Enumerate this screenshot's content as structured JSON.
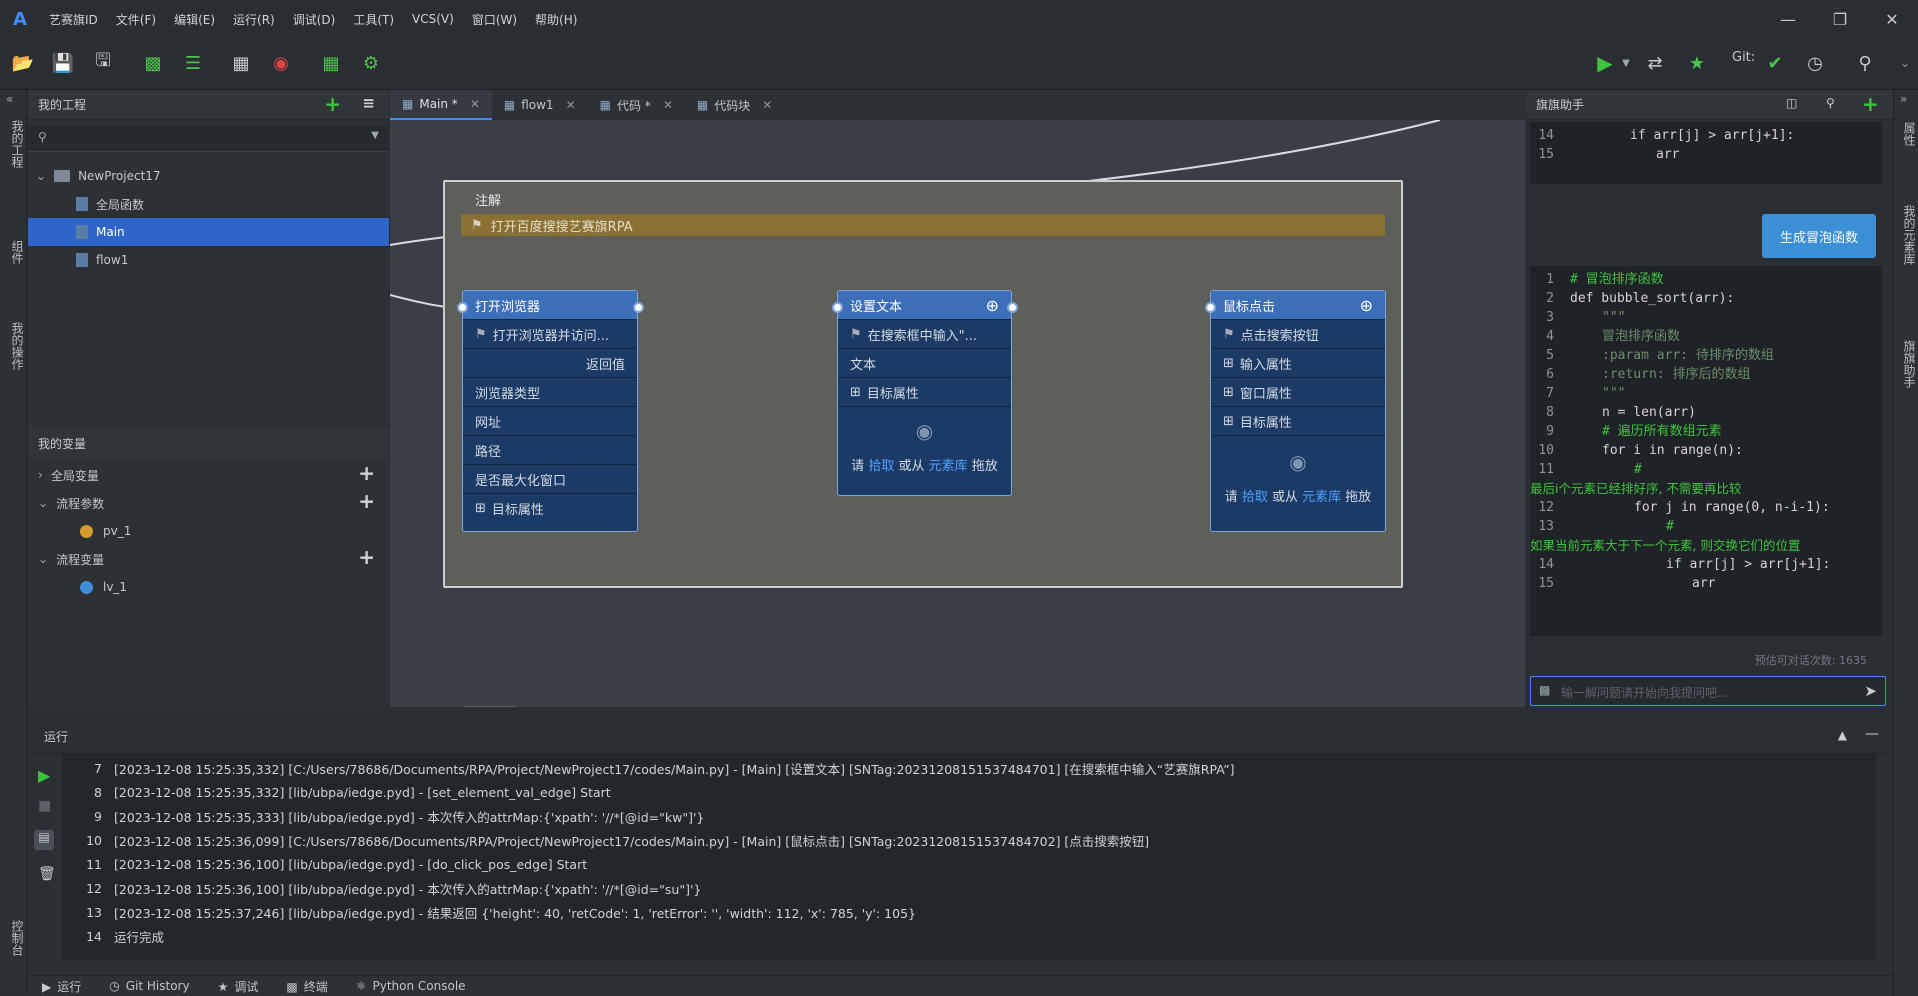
{
  "app": {
    "logo": "A",
    "menus": [
      "艺赛旗ID",
      "文件(F)",
      "编辑(E)",
      "运行(R)",
      "调试(D)",
      "工具(T)",
      "VCS(V)",
      "窗口(W)",
      "帮助(H)"
    ]
  },
  "toolbar": {
    "git_label": "Git:"
  },
  "leftstrip": {
    "tabs": [
      "我的工程",
      "组件",
      "我的操作"
    ],
    "bottom": "控制台"
  },
  "project": {
    "title": "我的工程",
    "root": "NewProject17",
    "items": [
      "全局函数",
      "Main",
      "flow1"
    ]
  },
  "variables": {
    "title": "我的变量",
    "groups": [
      "全局变量",
      "流程参数",
      "流程变量"
    ],
    "params": [
      "pv_1"
    ],
    "vars": [
      "lv_1"
    ]
  },
  "tabs": [
    {
      "label": "Main *"
    },
    {
      "label": "flow1"
    },
    {
      "label": "代码 *"
    },
    {
      "label": "代码块"
    }
  ],
  "annotation": {
    "title": "注解",
    "text": "打开百度搜搜艺赛旗RPA"
  },
  "nodes": [
    {
      "title": "打开浏览器",
      "comment": "打开浏览器并访问...",
      "rows": [
        "返回值",
        "浏览器类型",
        "网址",
        "路径",
        "是否最大化窗口",
        "目标属性"
      ]
    },
    {
      "title": "设置文本",
      "comment": "在搜索框中输入\"...",
      "rows": [
        "文本",
        "目标属性"
      ],
      "drop": [
        "请",
        "拾取",
        "或从",
        "元素库",
        "拖放"
      ]
    },
    {
      "title": "鼠标点击",
      "comment": "点击搜索按钮",
      "rows": [
        "输入属性",
        "窗口属性",
        "目标属性"
      ],
      "drop": [
        "请",
        "拾取",
        "或从",
        "元素库",
        "拖放"
      ]
    }
  ],
  "assistant": {
    "title": "旗旗助手",
    "top_code": [
      {
        "n": "14",
        "t": "if arr[j] > arr[j+1]:"
      },
      {
        "n": "15",
        "t": "arr"
      }
    ],
    "button": "生成冒泡函数",
    "code": [
      {
        "n": "1",
        "t": "# 冒泡排序函数"
      },
      {
        "n": "2",
        "t": "def bubble_sort(arr):"
      },
      {
        "n": "3",
        "t": "\"\"\""
      },
      {
        "n": "4",
        "t": "冒泡排序函数"
      },
      {
        "n": "5",
        "t": ":param arr: 待排序的数组"
      },
      {
        "n": "6",
        "t": ":return: 排序后的数组"
      },
      {
        "n": "7",
        "t": "\"\"\""
      },
      {
        "n": "8",
        "t": "n = len(arr)"
      },
      {
        "n": "9",
        "t": "# 遍历所有数组元素"
      },
      {
        "n": "10",
        "t": "for i in range(n):"
      },
      {
        "n": "11",
        "t": "#"
      },
      {
        "n": "",
        "t": "最后i个元素已经排好序, 不需要再比较"
      },
      {
        "n": "12",
        "t": "for j in range(0, n-i-1):"
      },
      {
        "n": "13",
        "t": "#"
      },
      {
        "n": "",
        "t": "如果当前元素大于下一个元素, 则交换它们的位置"
      },
      {
        "n": "14",
        "t": "if arr[j] > arr[j+1]:"
      },
      {
        "n": "15",
        "t": "arr"
      }
    ],
    "count_label": "预估可对话次数: 1635",
    "input_placeholder": "输一解问题请开始向我提问吧..."
  },
  "rightstrip": {
    "tabs": [
      "属性",
      "我的元素库",
      "旗旗助手"
    ]
  },
  "run": {
    "title": "运行",
    "lines": [
      {
        "n": "7",
        "t": "[2023-12-08 15:25:35,332] [C:/Users/78686/Documents/RPA/Project/NewProject17/codes/Main.py] - [Main] [设置文本] [SNTag:20231208151537484701] [在搜索框中输入“艺赛旗RPA”]"
      },
      {
        "n": "8",
        "t": "[2023-12-08 15:25:35,332] [lib/ubpa/iedge.pyd] - [set_element_val_edge] Start"
      },
      {
        "n": "9",
        "t": "[2023-12-08 15:25:35,333] [lib/ubpa/iedge.pyd] - 本次传入的attrMap:{'xpath': '//*[@id=\"kw\"]'}"
      },
      {
        "n": "10",
        "t": "[2023-12-08 15:25:36,099] [C:/Users/78686/Documents/RPA/Project/NewProject17/codes/Main.py] - [Main] [鼠标点击] [SNTag:20231208151537484702] [点击搜索按钮]"
      },
      {
        "n": "11",
        "t": "[2023-12-08 15:25:36,100] [lib/ubpa/iedge.pyd] - [do_click_pos_edge] Start"
      },
      {
        "n": "12",
        "t": "[2023-12-08 15:25:36,100] [lib/ubpa/iedge.pyd] - 本次传入的attrMap:{'xpath': '//*[@id=\"su\"]'}"
      },
      {
        "n": "13",
        "t": "[2023-12-08 15:25:37,246] [lib/ubpa/iedge.pyd] - 结果返回 {'height': 40, 'retCode': 1, 'retError': '', 'width': 112, 'x': 785, 'y': 105}"
      },
      {
        "n": "14",
        "t": "运行完成"
      }
    ]
  },
  "bottom_tabs": [
    "运行",
    "Git History",
    "调试",
    "终端",
    "Python Console"
  ],
  "colors": {
    "accent": "#3b8cff",
    "node_head": "#3d6fb8",
    "node_body": "#1b3a66",
    "annotation_bar": "#8a7032",
    "run_green": "#3cc43c"
  }
}
